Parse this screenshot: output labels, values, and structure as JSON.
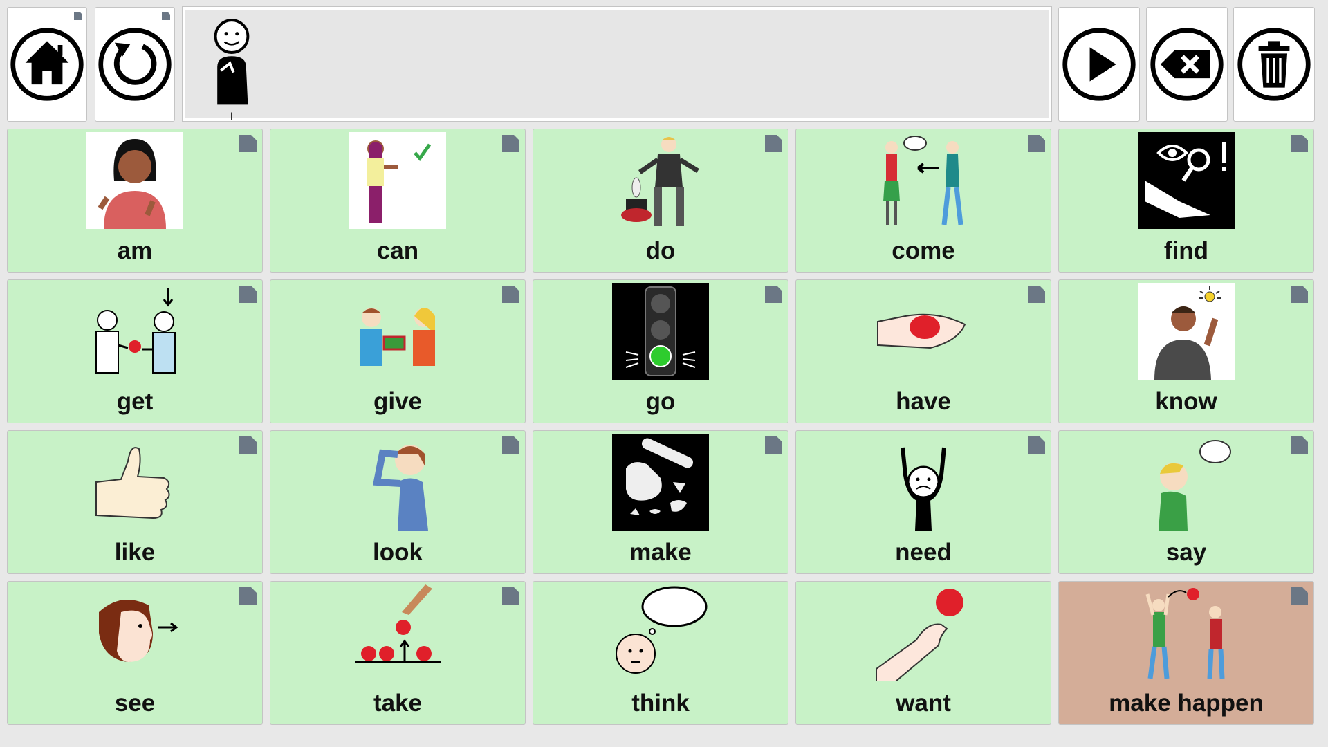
{
  "toolbar": {
    "home_icon": "home-icon",
    "back_icon": "undo-icon",
    "speak_icon": "play-icon",
    "backspace_icon": "backspace-icon",
    "clear_icon": "trash-icon"
  },
  "message": {
    "symbols": [
      {
        "icon": "person-self-icon",
        "label": "I"
      }
    ]
  },
  "colors": {
    "cell_default": "#c8f2c7",
    "cell_alt": "#d4ad98",
    "folder_corner": "#6b7785"
  },
  "grid": {
    "rows": [
      [
        {
          "label": "am",
          "icon": "woman-pointing-self-icon"
        },
        {
          "label": "can",
          "icon": "thumbs-up-check-icon"
        },
        {
          "label": "do",
          "icon": "magician-icon"
        },
        {
          "label": "come",
          "icon": "two-people-arrow-icon"
        },
        {
          "label": "find",
          "icon": "magnifier-eye-icon"
        }
      ],
      [
        {
          "label": "get",
          "icon": "give-ball-icon"
        },
        {
          "label": "give",
          "icon": "gift-exchange-icon"
        },
        {
          "label": "go",
          "icon": "traffic-light-green-icon"
        },
        {
          "label": "have",
          "icon": "hand-holding-ball-icon"
        },
        {
          "label": "know",
          "icon": "idea-man-icon"
        }
      ],
      [
        {
          "label": "like",
          "icon": "thumbs-up-icon"
        },
        {
          "label": "look",
          "icon": "man-looking-icon"
        },
        {
          "label": "make",
          "icon": "rolling-pin-icon"
        },
        {
          "label": "need",
          "icon": "sad-face-hands-icon"
        },
        {
          "label": "say",
          "icon": "speaking-boy-icon"
        }
      ],
      [
        {
          "label": "see",
          "icon": "head-eye-arrow-icon"
        },
        {
          "label": "take",
          "icon": "hand-picking-ball-icon"
        },
        {
          "label": "think",
          "icon": "thought-bubble-icon"
        },
        {
          "label": "want",
          "icon": "reaching-hand-ball-icon"
        },
        {
          "label": "make happen",
          "icon": "throw-ball-icon",
          "variant": "alt"
        }
      ]
    ]
  }
}
